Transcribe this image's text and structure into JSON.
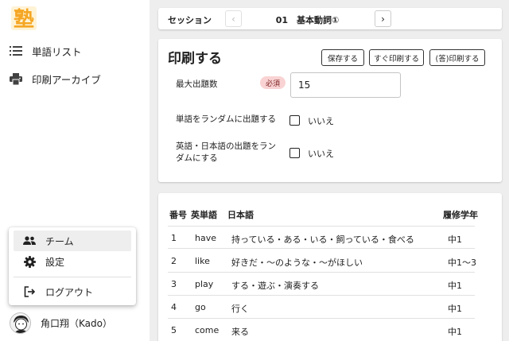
{
  "sidebar": {
    "logo_text": "塾",
    "nav": [
      {
        "label": "単語リスト",
        "icon": "list-icon"
      },
      {
        "label": "印刷アーカイブ",
        "icon": "printer-icon"
      }
    ],
    "menu": [
      {
        "label": "チーム",
        "icon": "team-icon"
      },
      {
        "label": "設定",
        "icon": "gear-icon"
      },
      {
        "label": "ログアウト",
        "icon": "logout-icon"
      }
    ],
    "user_name": "角口翔（Kado）"
  },
  "session": {
    "label": "セッション",
    "value": "01　基本動詞①",
    "prev": "‹",
    "next": "›"
  },
  "print": {
    "title": "印刷する",
    "buttons": {
      "save": "保存する",
      "print_now": "すぐ印刷する",
      "answer_print": "(答)印刷する"
    },
    "max_label": "最大出題数",
    "required": "必須",
    "max_value": "15",
    "random_words_label": "単語をランダムに出題する",
    "random_words_value": "いいえ",
    "random_lang_label_1": "英語・日本語の出題をラン",
    "random_lang_label_2": "ダムにする",
    "random_lang_value": "いいえ"
  },
  "table": {
    "headers": {
      "num": "番号",
      "en": "英単語",
      "ja": "日本語",
      "grade": "履修学年"
    },
    "rows": [
      {
        "num": "1",
        "en": "have",
        "ja": "持っている・ある・いる・飼っている・食べる",
        "grade": "中1"
      },
      {
        "num": "2",
        "en": "like",
        "ja": "好きだ・～のような・～がほしい",
        "grade": "中1～3"
      },
      {
        "num": "3",
        "en": "play",
        "ja": "する・遊ぶ・演奏する",
        "grade": "中1"
      },
      {
        "num": "4",
        "en": "go",
        "ja": "行く",
        "grade": "中1"
      },
      {
        "num": "5",
        "en": "come",
        "ja": "来る",
        "grade": "中1"
      }
    ]
  },
  "colors": {
    "logo": "#f5a623",
    "badge_bg": "#f9d3d3",
    "main_bg": "#eeeeee"
  }
}
